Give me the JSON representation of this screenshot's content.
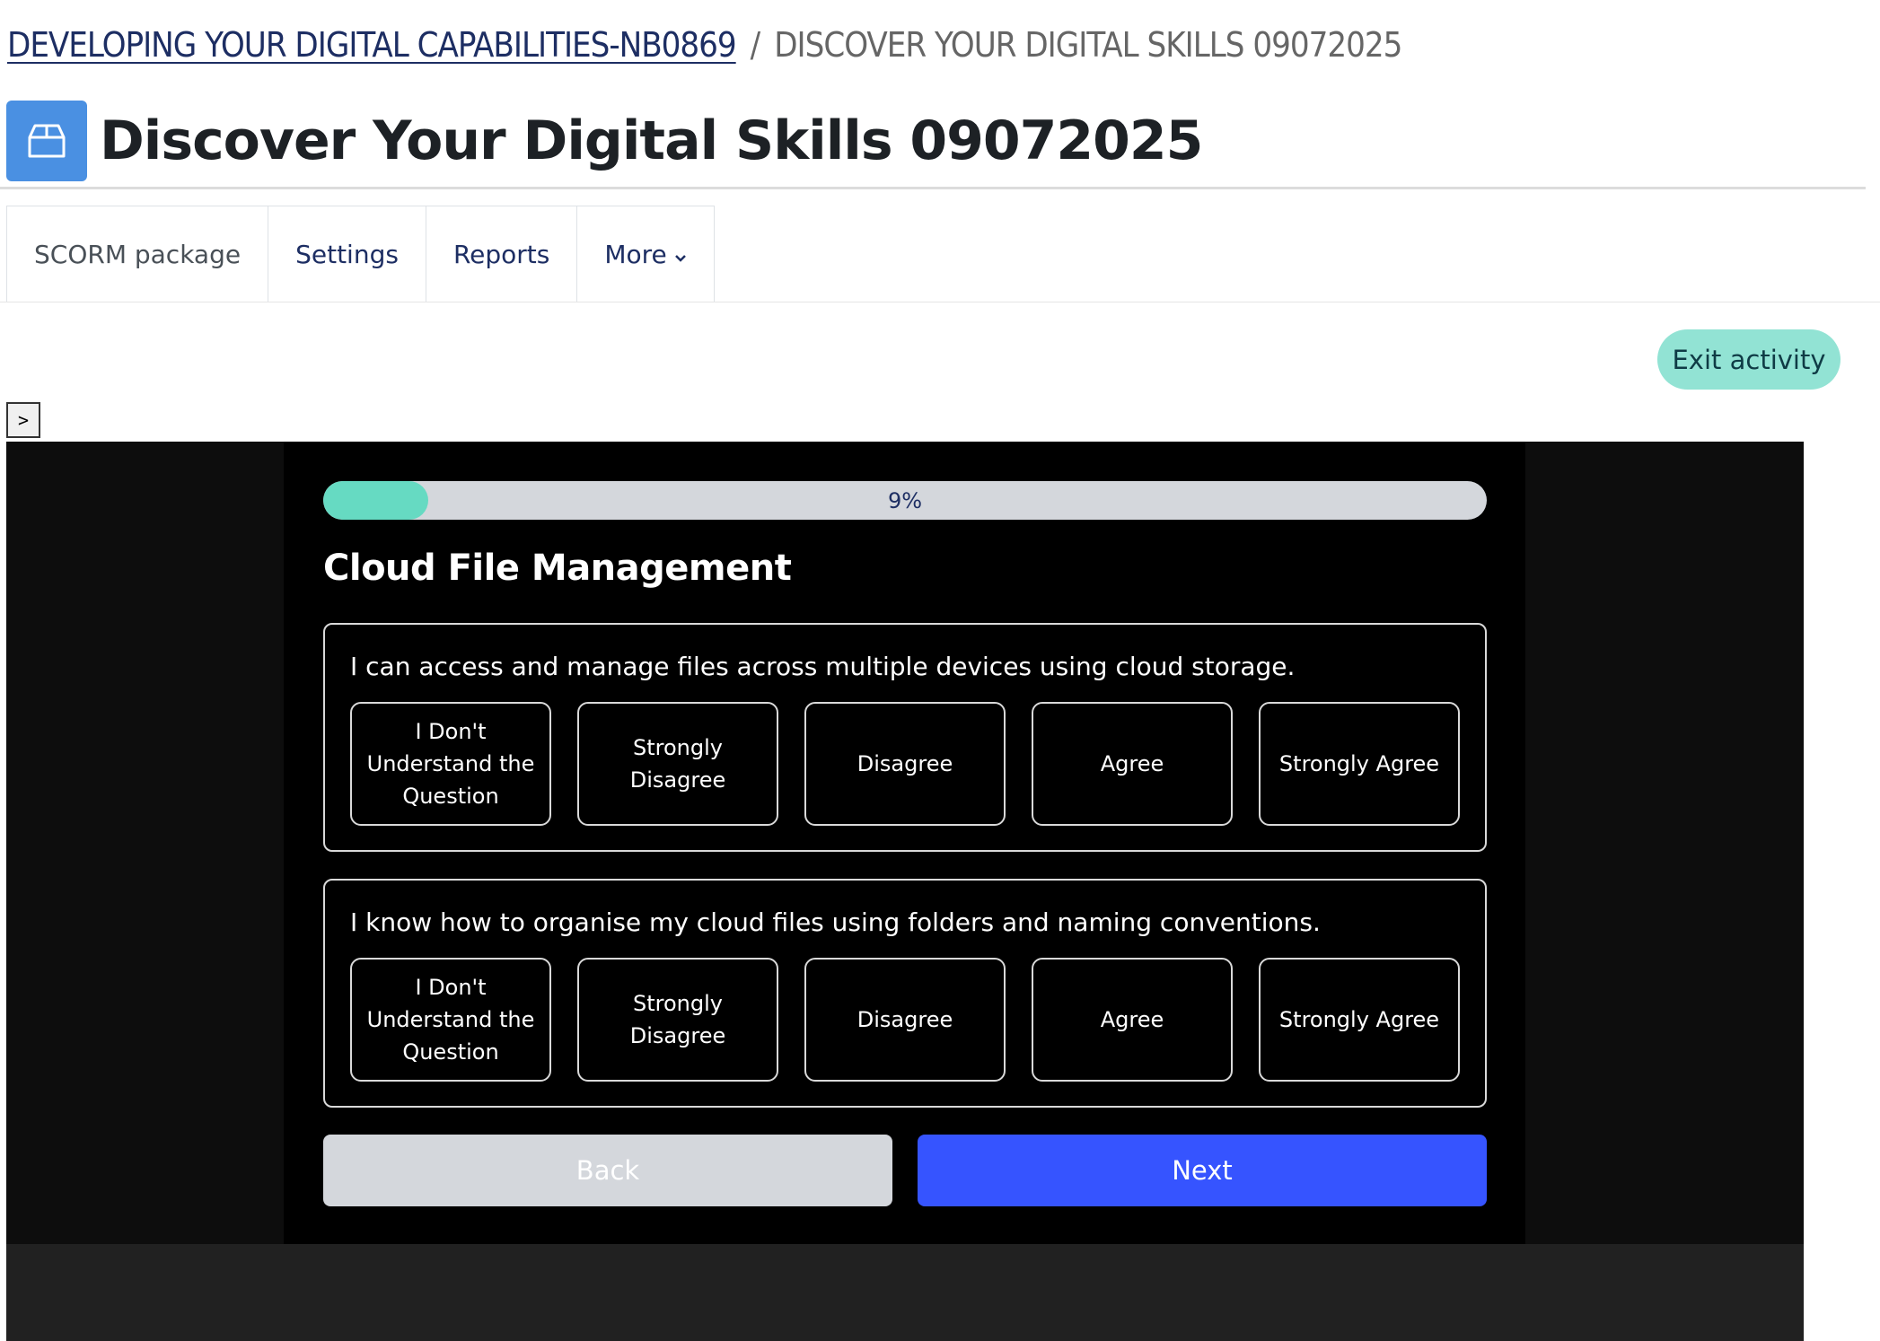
{
  "breadcrumb": {
    "course": "DEVELOPING YOUR DIGITAL CAPABILITIES-NB0869",
    "separator": "/",
    "current": "DISCOVER YOUR DIGITAL SKILLS 09072025"
  },
  "activity": {
    "icon": "scorm-package-icon",
    "title": "Discover Your Digital Skills 09072025"
  },
  "tabs": [
    {
      "label": "SCORM package"
    },
    {
      "label": "Settings"
    },
    {
      "label": "Reports"
    },
    {
      "label": "More"
    }
  ],
  "exit_label": "Exit activity",
  "toc_toggle_label": ">",
  "progress": {
    "percent": 9,
    "label": "9%"
  },
  "section_title": "Cloud File Management",
  "questions": [
    {
      "text": "I can access and manage files across multiple devices using cloud storage.",
      "options": [
        "I Don't Understand the Question",
        "Strongly Disagree",
        "Disagree",
        "Agree",
        "Strongly Agree"
      ]
    },
    {
      "text": "I know how to organise my cloud files using folders and naming conventions.",
      "options": [
        "I Don't Understand the Question",
        "Strongly Disagree",
        "Disagree",
        "Agree",
        "Strongly Agree"
      ]
    }
  ],
  "back_label": "Back",
  "next_label": "Next",
  "colors": {
    "accent_teal": "#66dac2",
    "next_blue": "#3654ff",
    "icon_blue": "#4a90e2",
    "exit_bg": "#92e3d4"
  }
}
